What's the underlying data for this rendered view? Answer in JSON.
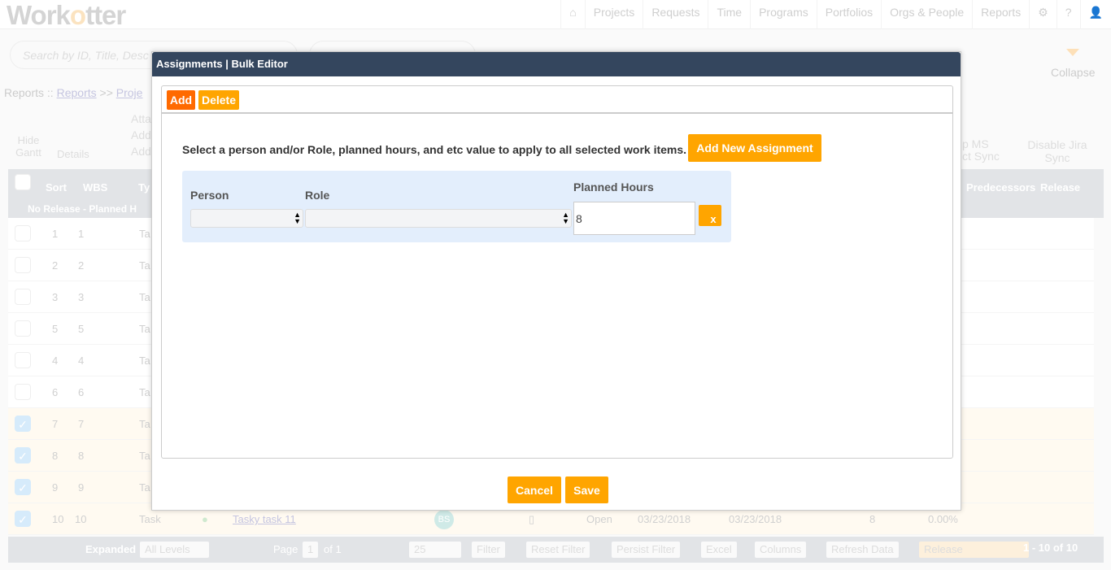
{
  "nav": {
    "logo": "WorkOtter",
    "items": [
      "Projects",
      "Requests",
      "Time",
      "Programs",
      "Portfolios",
      "Orgs & People",
      "Reports"
    ]
  },
  "search": {
    "placeholder": "Search by ID, Title, Desc"
  },
  "breadcrumb": {
    "root": "Reports ::",
    "link1": "Reports",
    ">>": ">>",
    "link2": "Proje"
  },
  "collapse": "Collapse",
  "toolbar": {
    "hide_gantt": "Hide Gantt",
    "details": "Details",
    "attach": "Atta",
    "add1": "Add",
    "add2": "Add",
    "ms_sync": "p MS ct Sync",
    "jira": "Disable Jira Sync"
  },
  "grid": {
    "headers": {
      "sort": "Sort",
      "wbs": "WBS",
      "type": "Ty",
      "predecessors": "Predecessors",
      "release": "Release"
    },
    "group": "No Release - Planned H",
    "rows": [
      {
        "sort": "1",
        "wbs": "1",
        "type": "Ta",
        "checked": false
      },
      {
        "sort": "2",
        "wbs": "2",
        "type": "Ta",
        "checked": false
      },
      {
        "sort": "3",
        "wbs": "3",
        "type": "Ta",
        "checked": false
      },
      {
        "sort": "5",
        "wbs": "5",
        "type": "Ta",
        "checked": false
      },
      {
        "sort": "4",
        "wbs": "4",
        "type": "Ta",
        "checked": false
      },
      {
        "sort": "6",
        "wbs": "6",
        "type": "Ta",
        "checked": false
      },
      {
        "sort": "7",
        "wbs": "7",
        "type": "Ta",
        "checked": true
      },
      {
        "sort": "8",
        "wbs": "8",
        "type": "Ta",
        "checked": true
      },
      {
        "sort": "9",
        "wbs": "9",
        "type": "Ta",
        "checked": true
      }
    ],
    "last_row": {
      "sort": "10",
      "wbs": "10",
      "type": "Task",
      "title": "Tasky task 11",
      "avatar": "BS",
      "status": "Open",
      "start": "03/23/2018",
      "end": "03/23/2018",
      "hours": "8",
      "pct": "0.00%"
    }
  },
  "footer": {
    "expanded": "Expanded",
    "levels": "All Levels",
    "page": "Page",
    "page_num": "1",
    "of": "of 1",
    "per_page": "25",
    "filter": "Filter",
    "reset": "Reset Filter",
    "persist": "Persist Filter",
    "excel": "Excel",
    "columns": "Columns",
    "refresh": "Refresh Data",
    "release": "Release",
    "count": "1 - 10 of 10"
  },
  "modal": {
    "title": "Assignments | Bulk Editor",
    "add": "Add",
    "delete": "Delete",
    "message": "Select a person and/or Role, planned hours, and etc value to apply to all selected work items.",
    "add_new": "Add New Assignment",
    "person_label": "Person",
    "role_label": "Role",
    "hours_label": "Planned Hours",
    "hours_value": "8",
    "remove": "x",
    "cancel": "Cancel",
    "save": "Save"
  },
  "colors": {
    "header": "#34465e",
    "orange": "#ffa500",
    "add_orange": "#ff6a00",
    "blue_box": "#e3eefc"
  }
}
